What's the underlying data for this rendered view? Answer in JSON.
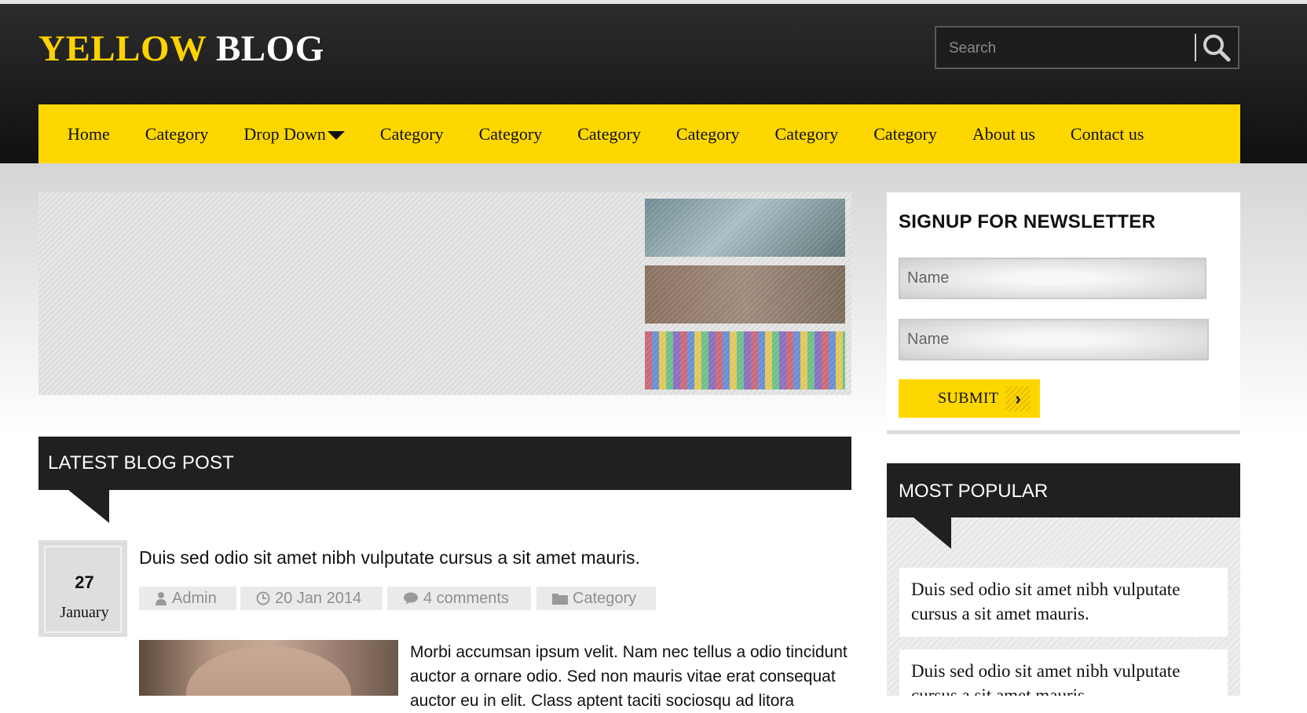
{
  "logo": {
    "part1": "YELLOW",
    "part2": "BLOG"
  },
  "search": {
    "placeholder": "Search",
    "icon": "search-icon"
  },
  "nav": {
    "items": [
      {
        "label": "Home"
      },
      {
        "label": "Category"
      },
      {
        "label": "Drop Down",
        "icon": "caret-down-icon"
      },
      {
        "label": "Category"
      },
      {
        "label": "Category"
      },
      {
        "label": "Category"
      },
      {
        "label": "Category"
      },
      {
        "label": "Category"
      },
      {
        "label": "Category"
      },
      {
        "label": "About us"
      },
      {
        "label": "Contact us"
      }
    ]
  },
  "newsletter": {
    "title": "SIGNUP FOR NEWSLETTER",
    "field1_placeholder": "Name",
    "field2_placeholder": "Name",
    "submit_label": "SUBMIT"
  },
  "latest": {
    "heading": "LATEST BLOG POST"
  },
  "post": {
    "day": "27",
    "month": "January",
    "title": "Duis sed odio sit amet nibh vulputate cursus a sit amet mauris.",
    "author": "Admin",
    "date": "20 Jan 2014",
    "comments": "4 comments",
    "category": "Category",
    "excerpt": "Morbi accumsan ipsum velit. Nam nec tellus a odio tincidunt auctor a ornare odio. Sed non mauris vitae erat consequat auctor eu in elit. Class aptent taciti sociosqu ad litora"
  },
  "popular": {
    "heading": "MOST POPULAR",
    "items": [
      {
        "text": "Duis sed odio sit amet nibh vulputate cursus a sit amet mauris."
      },
      {
        "text": "Duis sed odio sit amet nibh vulputate cursus a sit amet mauris."
      }
    ]
  },
  "colors": {
    "accent": "#ffd700",
    "header_bg": "#1a1a1a",
    "dark_heading": "#202020"
  }
}
